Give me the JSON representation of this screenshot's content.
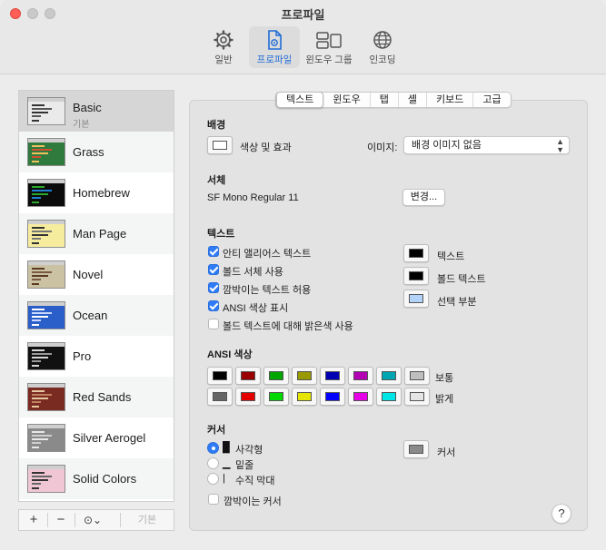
{
  "window": {
    "title": "프로파일"
  },
  "toolbar": {
    "items": [
      {
        "label": "일반",
        "icon": "gear-icon"
      },
      {
        "label": "프로파일",
        "icon": "profile-document-icon"
      },
      {
        "label": "윈도우 그룹",
        "icon": "window-group-icon"
      },
      {
        "label": "인코딩",
        "icon": "globe-icon"
      }
    ],
    "active": "프로파일"
  },
  "sidebar": {
    "profiles": [
      {
        "name": "Basic",
        "subtitle": "기본",
        "bg": "#eaeaea",
        "lines": [
          "#333333",
          "#555555"
        ]
      },
      {
        "name": "Grass",
        "subtitle": "",
        "bg": "#2f7a3d",
        "lines": [
          "#f0c060",
          "#d05030"
        ]
      },
      {
        "name": "Homebrew",
        "subtitle": "",
        "bg": "#0b0b0b",
        "lines": [
          "#2aa82a",
          "#1c7fd0"
        ]
      },
      {
        "name": "Man Page",
        "subtitle": "",
        "bg": "#f6ec9d",
        "lines": [
          "#333333",
          "#777777"
        ]
      },
      {
        "name": "Novel",
        "subtitle": "",
        "bg": "#cbc2a4",
        "lines": [
          "#5a3a20",
          "#7a5a40"
        ]
      },
      {
        "name": "Ocean",
        "subtitle": "",
        "bg": "#2a5ec9",
        "lines": [
          "#ffffff",
          "#c8d8ff"
        ]
      },
      {
        "name": "Pro",
        "subtitle": "",
        "bg": "#111111",
        "lines": [
          "#d8d8d8",
          "#9a9a9a"
        ]
      },
      {
        "name": "Red Sands",
        "subtitle": "",
        "bg": "#7a2b21",
        "lines": [
          "#e6c9a0",
          "#c08060"
        ]
      },
      {
        "name": "Silver Aerogel",
        "subtitle": "",
        "bg": "#8a8a8a",
        "lines": [
          "#e8e8e8",
          "#cfcfcf"
        ]
      },
      {
        "name": "Solid Colors",
        "subtitle": "",
        "bg": "#f0c6d4",
        "lines": [
          "#333333",
          "#666666"
        ]
      }
    ],
    "footer": {
      "add": "+",
      "remove": "−",
      "more": "⊙⌄",
      "default": "기본"
    }
  },
  "tabs": [
    "텍스트",
    "윈도우",
    "탭",
    "셸",
    "키보드",
    "고급"
  ],
  "active_tab": "텍스트",
  "background": {
    "title": "배경",
    "color_effects_label": "색상 및 효과",
    "image_label": "이미지:",
    "image_value": "배경 이미지 없음"
  },
  "font": {
    "title": "서체",
    "value": "SF Mono Regular 11",
    "change_button": "변경..."
  },
  "text": {
    "title": "텍스트",
    "options": [
      {
        "label": "안티 앨리어스 텍스트",
        "checked": true
      },
      {
        "label": "볼드 서체 사용",
        "checked": true
      },
      {
        "label": "깜박이는 텍스트 허용",
        "checked": true
      },
      {
        "label": "ANSI 색상 표시",
        "checked": true
      },
      {
        "label": "볼드 텍스트에 대해 밝은색 사용",
        "checked": false
      }
    ],
    "colors": [
      {
        "label": "텍스트",
        "color": "#000000"
      },
      {
        "label": "볼드 텍스트",
        "color": "#000000"
      },
      {
        "label": "선택 부분",
        "color": "#b4d3fb"
      }
    ]
  },
  "ansi": {
    "title": "ANSI 색상",
    "normal_label": "보통",
    "bright_label": "밝게",
    "normal": [
      "#000000",
      "#990000",
      "#00a600",
      "#999900",
      "#0000b2",
      "#b200b2",
      "#00a6b2",
      "#bfbfbf"
    ],
    "bright": [
      "#666666",
      "#e50000",
      "#00d900",
      "#e5e500",
      "#0000ff",
      "#e500e5",
      "#00e5e5",
      "#e5e5e5"
    ]
  },
  "cursor": {
    "title": "커서",
    "options": [
      {
        "glyph": "█",
        "label": "사각형",
        "selected": true
      },
      {
        "glyph": "▁",
        "label": "밑줄",
        "selected": false
      },
      {
        "glyph": "|",
        "label": "수직 막대",
        "selected": false
      }
    ],
    "blink_label": "깜박이는 커서",
    "blink_checked": false,
    "color_label": "커서",
    "color": "#8a8a8a"
  },
  "help": "?"
}
